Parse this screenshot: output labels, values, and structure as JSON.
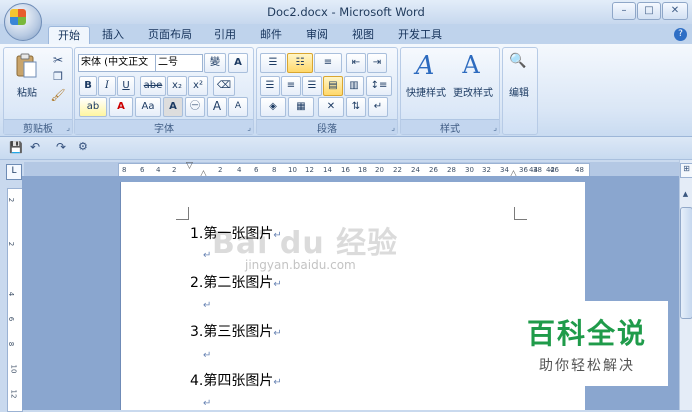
{
  "window": {
    "title": "Doc2.docx - Microsoft Word",
    "minimize": "–",
    "maximize": "□",
    "close": "✕"
  },
  "tabs": [
    {
      "label": "开始"
    },
    {
      "label": "插入"
    },
    {
      "label": "页面布局"
    },
    {
      "label": "引用"
    },
    {
      "label": "邮件"
    },
    {
      "label": "审阅"
    },
    {
      "label": "视图"
    },
    {
      "label": "开发工具"
    }
  ],
  "help": "?",
  "ribbon": {
    "clipboard": {
      "label": "剪贴板",
      "paste": "粘贴"
    },
    "font": {
      "label": "字体",
      "font_name": "宋体 (中文正文",
      "font_size": "二号",
      "bold": "B",
      "italic": "I",
      "underline": "U",
      "strike": "abe",
      "subscript": "x₂",
      "superscript": "x²",
      "font_color": "A",
      "change_case": "Aa",
      "grow": "A",
      "shrink": "A"
    },
    "paragraph": {
      "label": "段落"
    },
    "styles": {
      "label": "样式",
      "quick_styles": "快捷样式",
      "change_styles": "更改样式"
    },
    "editing": {
      "label": "编辑"
    }
  },
  "ruler_ticks": [
    "8",
    "6",
    "4",
    "2",
    "2",
    "4",
    "6",
    "8",
    "10",
    "12",
    "14",
    "16",
    "18",
    "20",
    "22",
    "24",
    "26",
    "28",
    "30",
    "32",
    "34",
    "36",
    "38",
    "42",
    "44",
    "46",
    "48"
  ],
  "vruler_ticks": [
    "2",
    "2",
    "4",
    "6",
    "8",
    "10",
    "12",
    "14"
  ],
  "document": {
    "lines": [
      "1.第一张图片",
      "2.第二张图片",
      "3.第三张图片",
      "4.第四张图片"
    ],
    "para_mark": "↵"
  },
  "watermark": {
    "text": "Bai du 经验",
    "url": "jingyan.baidu.com"
  },
  "badge": {
    "title": "百科全说",
    "subtitle": "助你轻松解决"
  }
}
